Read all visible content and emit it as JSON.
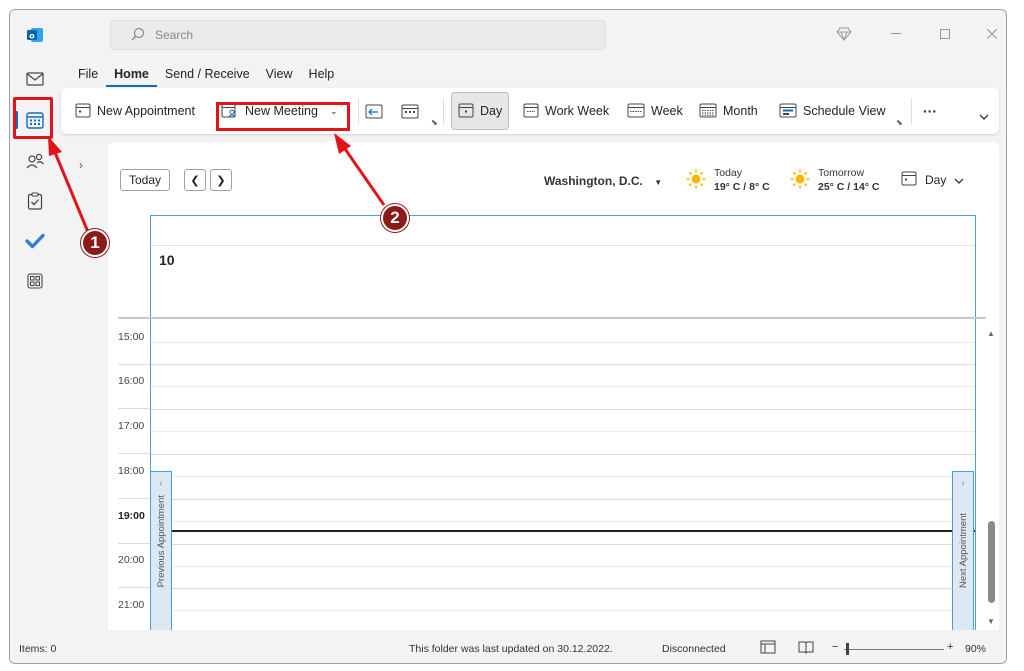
{
  "search": {
    "placeholder": "Search"
  },
  "menu": {
    "tabs": [
      "File",
      "Home",
      "Send / Receive",
      "View",
      "Help"
    ],
    "active": "Home"
  },
  "ribbon": {
    "new_appointment": "New Appointment",
    "new_meeting": "New Meeting",
    "day": "Day",
    "work_week": "Work Week",
    "week": "Week",
    "month": "Month",
    "schedule_view": "Schedule View",
    "more": "···"
  },
  "calendar_header": {
    "today_button": "Today",
    "location": "Washington,  D.C.",
    "weather_today_label": "Today",
    "weather_today_temp": "19° C / 8° C",
    "weather_tomorrow_label": "Tomorrow",
    "weather_tomorrow_temp": "25° C / 14° C",
    "view_selector": "Day"
  },
  "day": {
    "number": "10"
  },
  "times": [
    "15:00",
    "16:00",
    "17:00",
    "18:00",
    "19:00",
    "20:00",
    "21:00"
  ],
  "current_hour": "19:00",
  "side_tabs": {
    "previous": "Previous Appointment",
    "next": "Next Appointment"
  },
  "status": {
    "items": "Items: 0",
    "last_updated": "This folder was last updated on 30.12.2022.",
    "connection": "Disconnected",
    "zoom": "90%"
  },
  "annotations": {
    "step1": "1",
    "step2": "2"
  },
  "colors": {
    "accent": "#0f6cbd",
    "annotation_red": "#e1141c",
    "badge": "#8b1a1a"
  }
}
